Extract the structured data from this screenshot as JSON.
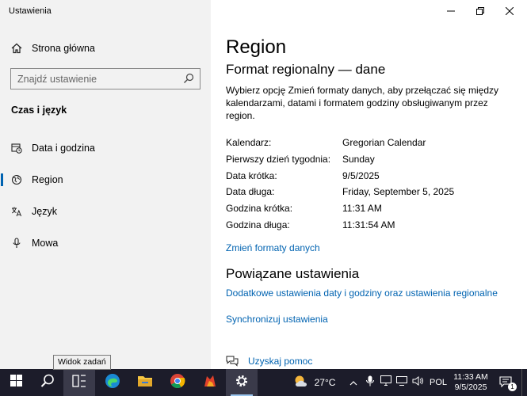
{
  "window": {
    "title": "Ustawienia",
    "controls": [
      "minimize-icon",
      "maximize-icon",
      "close-icon"
    ]
  },
  "sidebar": {
    "home_label": "Strona główna",
    "search_placeholder": "Znajdź ustawienie",
    "section_header": "Czas i język",
    "items": [
      {
        "label": "Data i godzina",
        "icon": "calendar-clock-icon",
        "selected": false
      },
      {
        "label": "Region",
        "icon": "globe-icon",
        "selected": true
      },
      {
        "label": "Język",
        "icon": "language-icon",
        "selected": false
      },
      {
        "label": "Mowa",
        "icon": "microphone-icon",
        "selected": false
      }
    ]
  },
  "main": {
    "title": "Region",
    "subtitle": "Format regionalny — dane",
    "description": "Wybierz opcję Zmień formaty danych, aby przełączać się między kalendarzami, datami i formatem godziny obsługiwanym przez region.",
    "details": [
      {
        "key": "Kalendarz:",
        "value": "Gregorian Calendar"
      },
      {
        "key": "Pierwszy dzień tygodnia:",
        "value": "Sunday"
      },
      {
        "key": "Data krótka:",
        "value": "9/5/2025"
      },
      {
        "key": "Data długa:",
        "value": "Friday, September 5, 2025"
      },
      {
        "key": "Godzina krótka:",
        "value": "11:31 AM"
      },
      {
        "key": "Godzina długa:",
        "value": "11:31:54 AM"
      }
    ],
    "change_formats_link": "Zmień formaty danych",
    "related_header": "Powiązane ustawienia",
    "related_links": [
      "Dodatkowe ustawienia daty i godziny oraz ustawienia regionalne",
      "Synchronizuj ustawienia"
    ],
    "help_link": "Uzyskaj pomoc"
  },
  "tooltip": "Widok zadań",
  "taskbar": {
    "apps": [
      "windows-start-icon",
      "search-icon",
      "task-view-icon",
      "edge-icon",
      "file-explorer-icon",
      "chrome-icon",
      "app-icon",
      "settings-icon"
    ],
    "weather_temp": "27°C",
    "language": "POL",
    "time": "11:33 AM",
    "date": "9/5/2025",
    "notification_count": "1",
    "colors": {
      "background": "#1c1c2a",
      "accent": "#0063b1"
    }
  }
}
